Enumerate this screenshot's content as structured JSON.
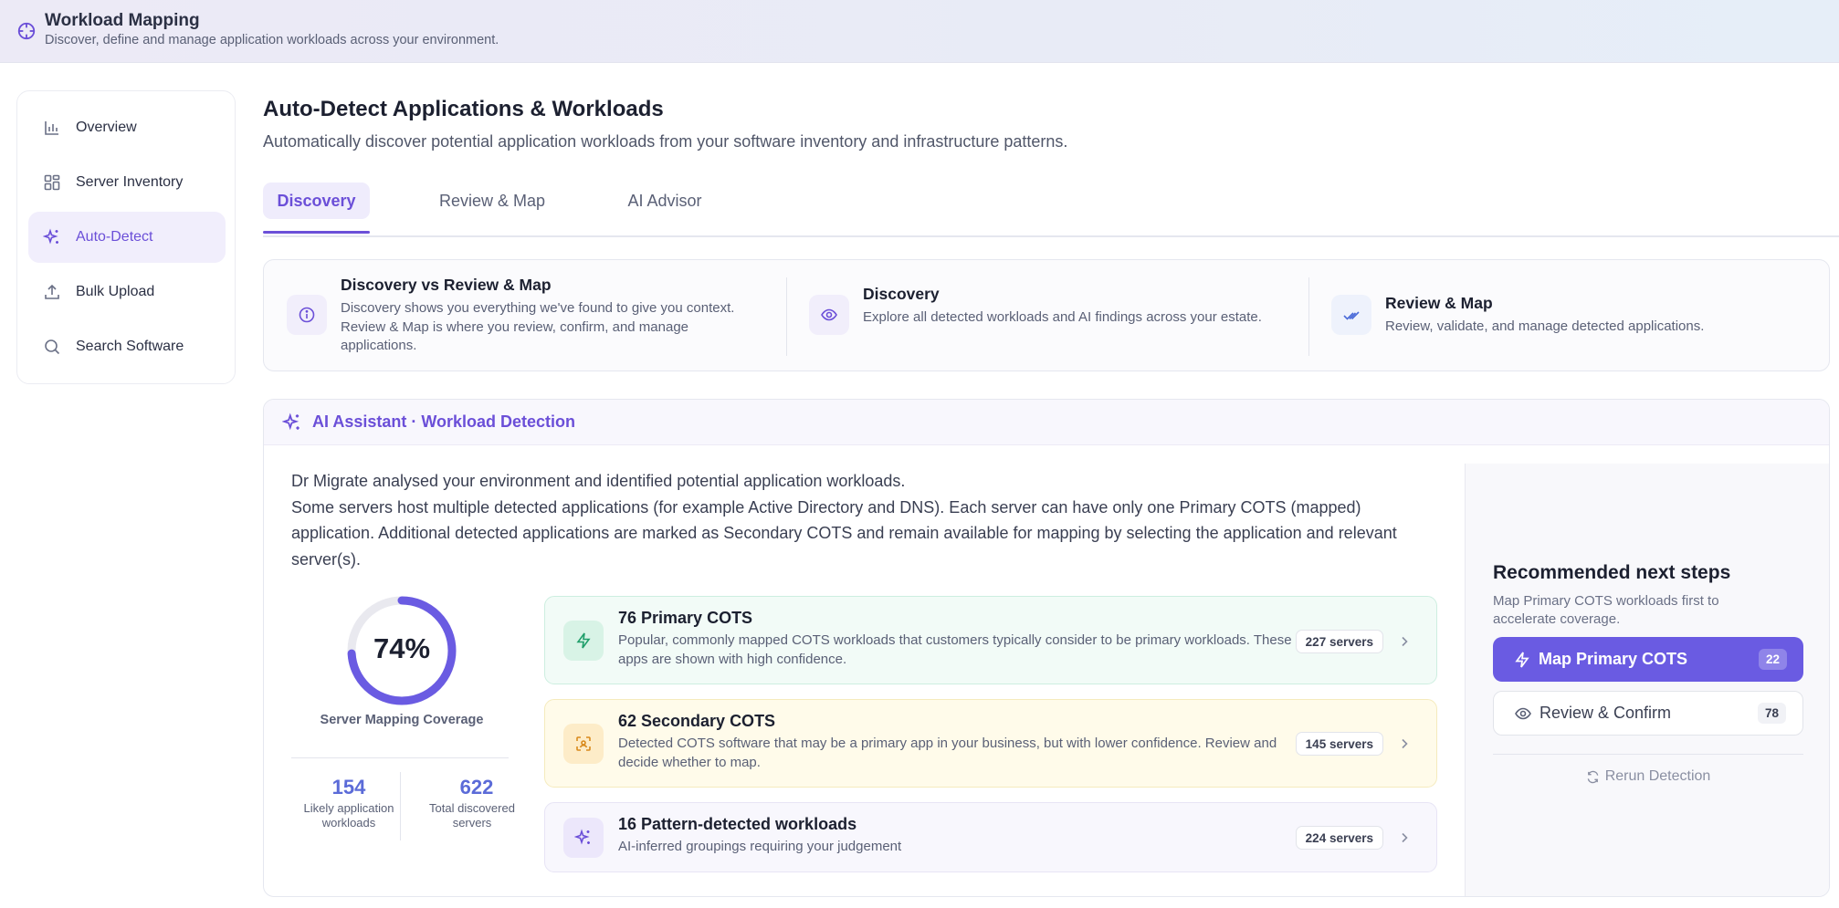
{
  "header": {
    "title": "Workload Mapping",
    "subtitle": "Discover, define and manage application workloads across your environment.",
    "icon": "crosshair-icon"
  },
  "sidebar": {
    "items": [
      {
        "label": "Overview",
        "icon": "bar-chart-icon",
        "active": false
      },
      {
        "label": "Server Inventory",
        "icon": "grid-icon",
        "active": false
      },
      {
        "label": "Auto-Detect",
        "icon": "sparkles-icon",
        "active": true
      },
      {
        "label": "Bulk Upload",
        "icon": "upload-icon",
        "active": false
      },
      {
        "label": "Search Software",
        "icon": "search-icon",
        "active": false
      }
    ]
  },
  "main": {
    "title": "Auto-Detect Applications & Workloads",
    "subtitle": "Automatically discover potential application workloads from your software inventory and infrastructure patterns.",
    "tabs": [
      {
        "label": "Discovery",
        "active": true
      },
      {
        "label": "Review & Map",
        "active": false
      },
      {
        "label": "AI Advisor",
        "active": false
      }
    ]
  },
  "info": {
    "sections": [
      {
        "title": "Discovery vs Review & Map",
        "desc": "Discovery shows you everything we've found to give you context. Review & Map is where you review, confirm, and manage applications.",
        "icon": "info-icon"
      },
      {
        "title": "Discovery",
        "desc": "Explore all detected workloads and AI findings across your estate.",
        "icon": "eye-icon"
      },
      {
        "title": "Review & Map",
        "desc": "Review, validate, and manage detected applications.",
        "icon": "double-check-icon"
      }
    ]
  },
  "ai": {
    "title": "AI Assistant · Workload Detection",
    "para1": "Dr Migrate analysed your environment and identified potential application workloads.",
    "para2": "Some servers host multiple detected applications (for example Active Directory and DNS). Each server can have only one Primary COTS (mapped) application. Additional detected applications are marked as Secondary COTS and remain available for mapping by selecting the application and relevant server(s).",
    "coverage": {
      "percent_text": "74%",
      "value": 0.74,
      "label": "Server Mapping Coverage"
    },
    "stats": [
      {
        "value": "154",
        "label": "Likely application workloads"
      },
      {
        "value": "622",
        "label": "Total discovered servers"
      }
    ],
    "cots": [
      {
        "title": "76 Primary COTS",
        "desc": "Popular, commonly mapped COTS workloads that customers typically consider to be primary workloads. These apps are shown with high confidence.",
        "servers": "227 servers",
        "icon": "bolt-icon"
      },
      {
        "title": "62 Secondary COTS",
        "desc": "Detected COTS software that may be a primary app in your business, but with lower confidence. Review and decide whether to map.",
        "servers": "145 servers",
        "icon": "scan-focus-icon"
      },
      {
        "title": "16 Pattern-detected workloads",
        "desc": "AI-inferred groupings requiring your judgement",
        "servers": "224 servers",
        "icon": "sparkles-icon"
      }
    ],
    "next_steps": {
      "title": "Recommended next steps",
      "subtitle": "Map Primary COTS workloads first to accelerate coverage.",
      "primary_button": {
        "label": "Map Primary COTS",
        "count": "22"
      },
      "secondary_button": {
        "label": "Review & Confirm",
        "count": "78"
      },
      "rerun": "Rerun Detection"
    }
  },
  "colors": {
    "accent": "#6b4fd8",
    "primary_card_bg": "#f2fbf7",
    "secondary_card_bg": "#fffbea",
    "pattern_card_bg": "#f8f7fd",
    "donut": "#6a5be2"
  }
}
